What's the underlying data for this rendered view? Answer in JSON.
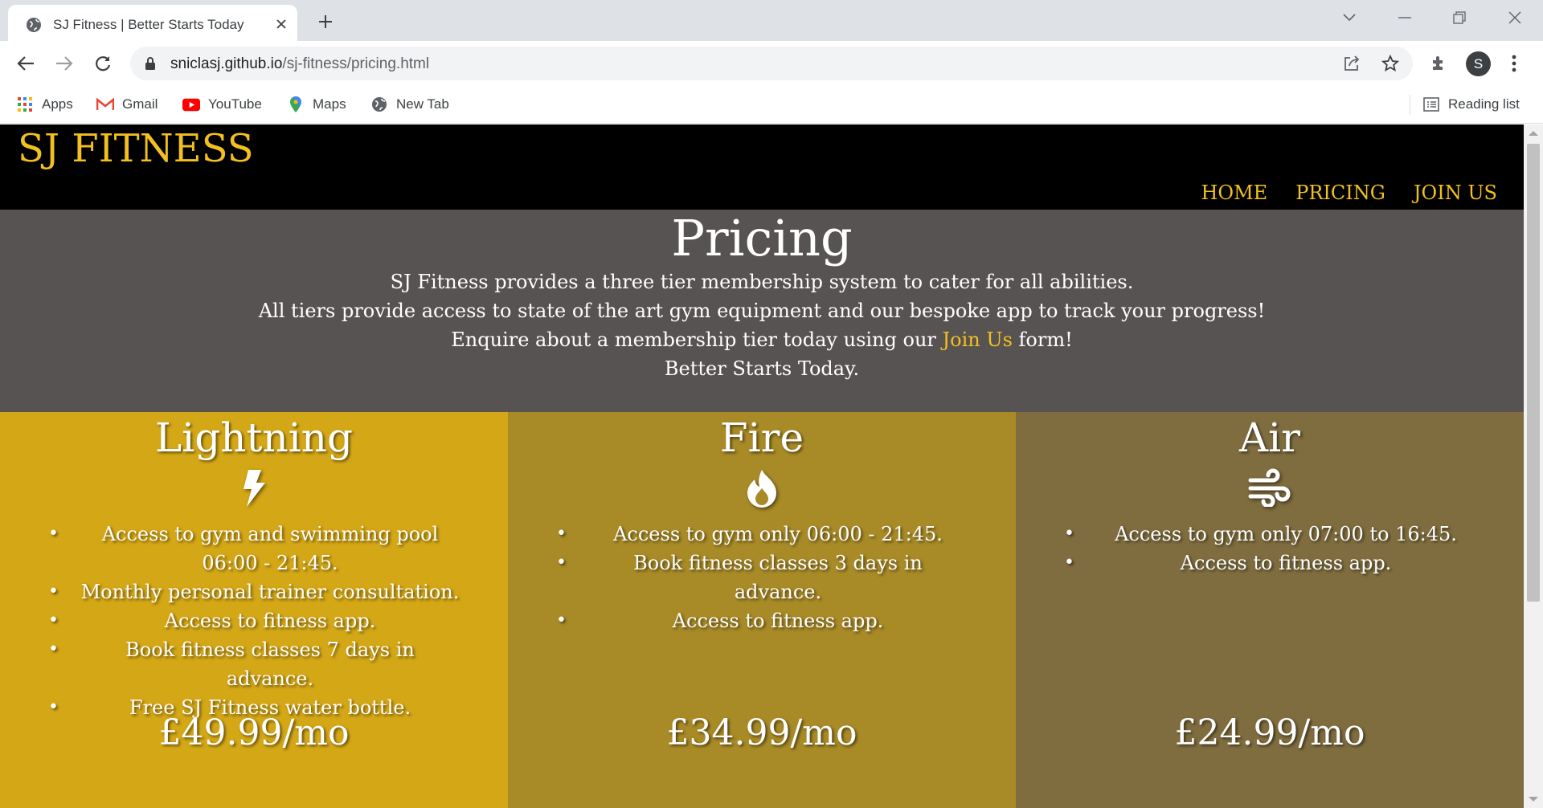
{
  "browser": {
    "tab_title": "SJ Fitness | Better Starts Today",
    "url_host": "sniclasj.github.io",
    "url_path": "/sj-fitness/pricing.html",
    "profile_initial": "S",
    "bookmarks": [
      {
        "label": "Apps",
        "icon": "apps-grid-icon"
      },
      {
        "label": "Gmail",
        "icon": "gmail-icon"
      },
      {
        "label": "YouTube",
        "icon": "youtube-icon"
      },
      {
        "label": "Maps",
        "icon": "maps-pin-icon"
      },
      {
        "label": "New Tab",
        "icon": "globe-icon"
      }
    ],
    "reading_list": "Reading list"
  },
  "site": {
    "logo": "SJ FITNESS",
    "nav": [
      "HOME",
      "PRICING",
      "JOIN US"
    ],
    "accent": "#f2c01f"
  },
  "intro": {
    "heading": "Pricing",
    "line1": "SJ Fitness provides a three tier membership system to cater for all abilities.",
    "line2": "All tiers provide access to state of the art gym equipment and our bespoke app to track your progress!",
    "line3_pre": "Enquire about a membership tier today using our ",
    "line3_link": "Join Us",
    "line3_post": " form!",
    "line4": "Better Starts Today."
  },
  "tiers": [
    {
      "name": "Lightning",
      "icon": "lightning-bolt-icon",
      "color": "#d4a716",
      "features": [
        "Access to gym and swimming pool 06:00 - 21:45.",
        "Monthly personal trainer consultation.",
        "Access to fitness app.",
        "Book fitness classes 7 days in advance.",
        "Free SJ Fitness water bottle."
      ],
      "price": "£49.99/mo"
    },
    {
      "name": "Fire",
      "icon": "fire-icon",
      "color": "#a88a27",
      "features": [
        "Access to gym only 06:00 - 21:45.",
        "Book fitness classes 3 days in advance.",
        "Access to fitness app."
      ],
      "price": "£34.99/mo"
    },
    {
      "name": "Air",
      "icon": "wind-icon",
      "color": "#7f6d3f",
      "features": [
        "Access to gym only 07:00 to 16:45.",
        "Access to fitness app."
      ],
      "price": "£24.99/mo"
    }
  ]
}
